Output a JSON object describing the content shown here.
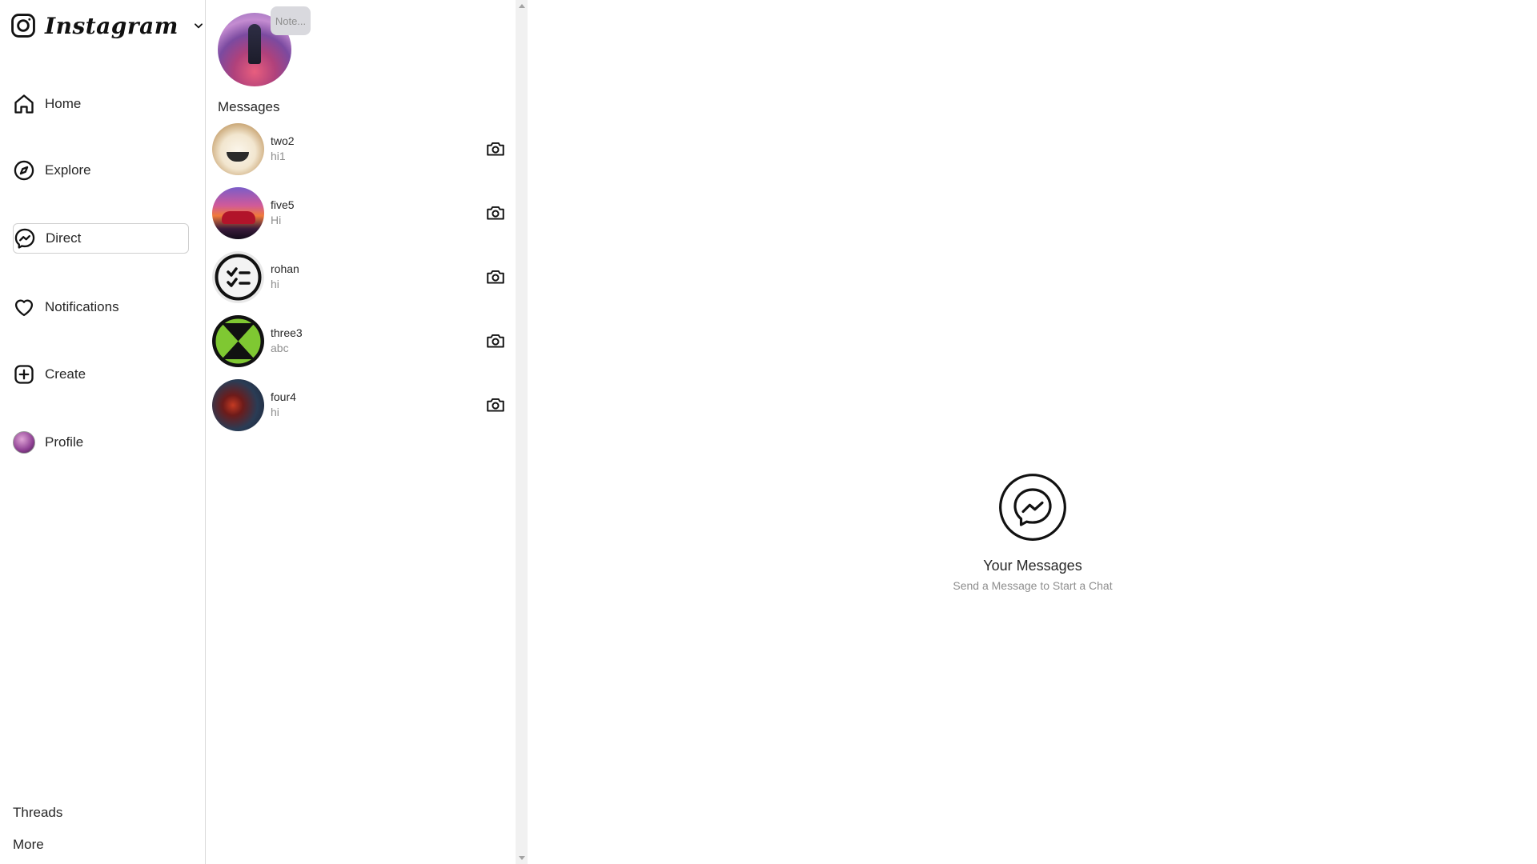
{
  "brand": {
    "wordmark": "Instagram",
    "logo_icon": "instagram-icon",
    "switcher_icon": "chevron-down-icon"
  },
  "sidebar": {
    "items": [
      {
        "label": "Home",
        "icon": "home-icon"
      },
      {
        "label": "Explore",
        "icon": "compass-icon"
      },
      {
        "label": "Direct",
        "icon": "messenger-icon",
        "active": true
      },
      {
        "label": "Notifications",
        "icon": "heart-icon"
      },
      {
        "label": "Create",
        "icon": "plus-square-icon"
      },
      {
        "label": "Profile",
        "icon": "avatar"
      }
    ],
    "bottom": [
      {
        "label": "Threads"
      },
      {
        "label": "More"
      }
    ]
  },
  "messages": {
    "note_placeholder": "Note...",
    "section_title": "Messages",
    "conversations": [
      {
        "username": "two2",
        "preview": "hi1"
      },
      {
        "username": "five5",
        "preview": "Hi"
      },
      {
        "username": "rohan",
        "preview": "hi"
      },
      {
        "username": "three3",
        "preview": "abc"
      },
      {
        "username": "four4",
        "preview": "hi"
      }
    ]
  },
  "empty_state": {
    "icon": "messenger-icon",
    "title": "Your Messages",
    "subtitle": "Send a Message to Start a Chat"
  },
  "colors": {
    "text": "#262626",
    "muted": "#8e8e8e",
    "border": "#dbdbdb",
    "note_bg": "#d9d9de"
  }
}
